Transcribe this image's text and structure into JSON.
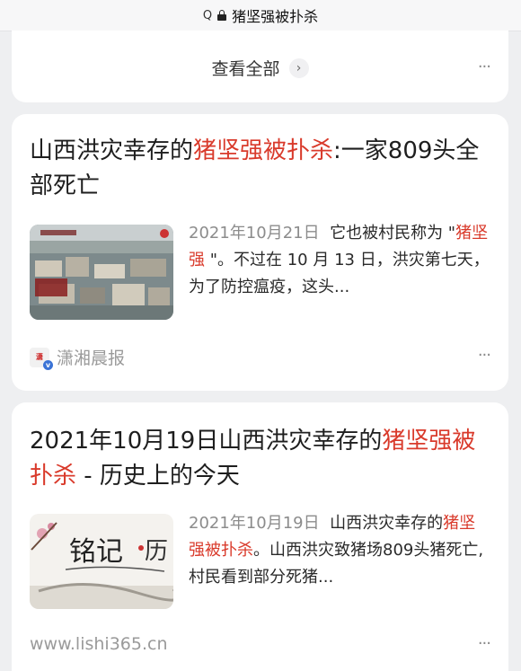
{
  "browser": {
    "search_glyph": "Q",
    "url_title": "猪坚强被扑杀"
  },
  "top_card": {
    "view_all": "查看全部",
    "chevron": "›",
    "more": "···"
  },
  "results": [
    {
      "title_pre": "山西洪灾幸存的",
      "title_hl": "猪坚强被扑杀",
      "title_post": ":一家809头全部死亡",
      "date": "2021年10月21日",
      "snippet_pre": "它也被村民称为 \"",
      "snippet_hl": "猪坚强",
      "snippet_post": " \"。不过在 10 月 13 日，洪灾第七天，为了防控瘟疫，这头...",
      "source": "潇湘晨报",
      "thumbnail_icon": "flood-aerial-photo",
      "more": "···"
    },
    {
      "title_pre": "2021年10月19日山西洪灾幸存的",
      "title_hl": "猪坚强被扑杀",
      "title_post": " - 历史上的今天",
      "date": "2021年10月19日",
      "snippet_pre": "山西洪灾幸存的",
      "snippet_hl": "猪坚强被扑杀",
      "snippet_post": "。山西洪灾致猪场809头猪死亡,村民看到部分死猪...",
      "source": "www.lishi365.cn",
      "thumbnail_icon": "history-calligraphy-banner",
      "more": "···"
    }
  ],
  "colors": {
    "highlight": "#d93a2b",
    "meta_gray": "#9a9a9a",
    "background": "#eeeff1"
  }
}
